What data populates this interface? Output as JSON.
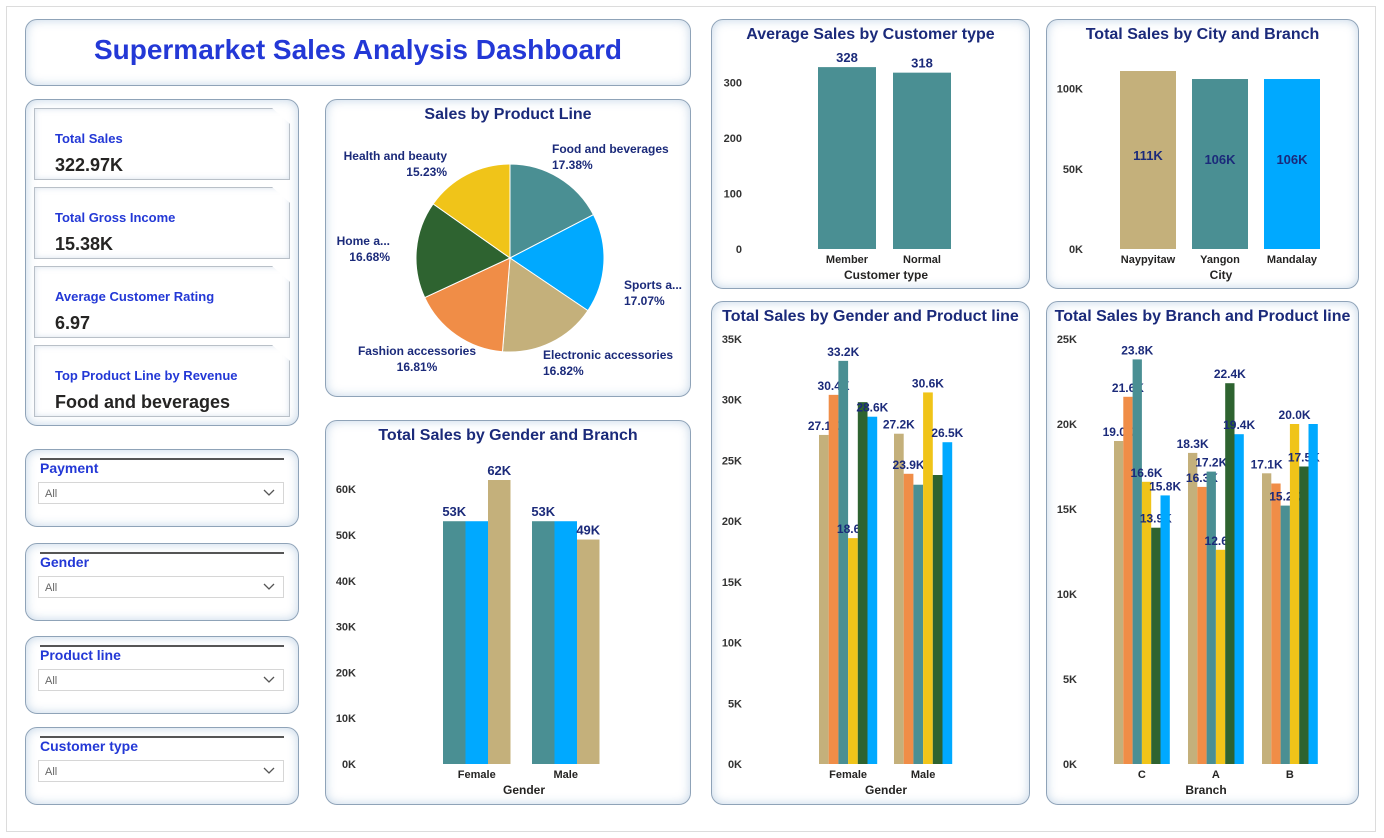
{
  "title": "Supermarket Sales Analysis Dashboard",
  "kpis": [
    {
      "label": "Total Sales",
      "value": "322.97K"
    },
    {
      "label": "Total Gross Income",
      "value": "15.38K"
    },
    {
      "label": "Average Customer Rating",
      "value": "6.97"
    },
    {
      "label": "Top Product Line by Revenue",
      "value": "Food and beverages"
    }
  ],
  "slicers": [
    {
      "title": "Payment",
      "value": "All"
    },
    {
      "title": "Gender",
      "value": "All"
    },
    {
      "title": "Product line",
      "value": "All"
    },
    {
      "title": "Customer type",
      "value": "All"
    }
  ],
  "colors": {
    "title": "#2338d6",
    "chart_title": "#1b2a7a",
    "teal": "#4a8f93",
    "blue": "#00a9ff",
    "tan": "#c4b07b",
    "orange": "#f08d47",
    "yellow": "#f0c419",
    "darkgreen": "#2e6330"
  },
  "chart_data": [
    {
      "id": "pie",
      "type": "pie",
      "title": "Sales by Product Line",
      "slices": [
        {
          "label": "Food and beverages",
          "pct_label": "17.38%",
          "value": 17.38,
          "color": "#4a8f93"
        },
        {
          "label": "Sports a...",
          "pct_label": "17.07%",
          "value": 17.07,
          "color": "#00a9ff"
        },
        {
          "label": "Electronic accessories",
          "pct_label": "16.82%",
          "value": 16.82,
          "color": "#c4b07b"
        },
        {
          "label": "Fashion accessories",
          "pct_label": "16.81%",
          "value": 16.81,
          "color": "#f08d47"
        },
        {
          "label": "Home a...",
          "pct_label": "16.68%",
          "value": 16.68,
          "color": "#2e6330"
        },
        {
          "label": "Health and beauty",
          "pct_label": "15.23%",
          "value": 15.23,
          "color": "#f0c419"
        }
      ]
    },
    {
      "id": "avg_cust",
      "type": "bar",
      "title": "Average Sales by Customer type",
      "xlabel": "Customer type",
      "ylabel": "",
      "categories": [
        "Member",
        "Normal"
      ],
      "ylim": [
        0,
        330
      ],
      "ticks": [
        0,
        100,
        200,
        300
      ],
      "tick_labels": [
        "0",
        "100",
        "200",
        "300"
      ],
      "series": [
        {
          "color": "#4a8f93",
          "values": [
            328,
            318
          ],
          "labels": [
            "328",
            "318"
          ]
        }
      ]
    },
    {
      "id": "city_branch",
      "type": "bar",
      "title": "Total Sales by City and Branch",
      "xlabel": "City",
      "ylabel": "",
      "categories": [
        "Naypyitaw",
        "Yangon",
        "Mandalay"
      ],
      "ylim": [
        0,
        111000
      ],
      "ticks": [
        0,
        50000,
        100000
      ],
      "tick_labels": [
        "0K",
        "50K",
        "100K"
      ],
      "series": [
        {
          "colors": [
            "#c4b07b",
            "#4a8f93",
            "#00a9ff"
          ],
          "values": [
            111000,
            106000,
            106000
          ],
          "labels": [
            "111K",
            "106K",
            "106K"
          ]
        }
      ]
    },
    {
      "id": "gender_branch",
      "type": "bar",
      "title": "Total Sales by Gender and Branch",
      "xlabel": "Gender",
      "ylabel": "",
      "categories": [
        "Female",
        "Male"
      ],
      "ylim": [
        0,
        62000
      ],
      "ticks": [
        0,
        10000,
        20000,
        30000,
        40000,
        50000,
        60000
      ],
      "tick_labels": [
        "0K",
        "10K",
        "20K",
        "30K",
        "40K",
        "50K",
        "60K"
      ],
      "series": [
        {
          "color": "#4a8f93",
          "values": [
            53000,
            53000
          ],
          "labels": [
            "53K",
            "53K"
          ]
        },
        {
          "color": "#00a9ff",
          "values": [
            53000,
            53000
          ],
          "labels": [
            "",
            ""
          ]
        },
        {
          "color": "#c4b07b",
          "values": [
            62000,
            49000
          ],
          "labels": [
            "62K",
            "49K"
          ]
        }
      ]
    },
    {
      "id": "gender_product",
      "type": "bar",
      "title": "Total Sales by Gender and Product line",
      "xlabel": "Gender",
      "ylabel": "",
      "categories": [
        "Female",
        "Male"
      ],
      "ylim": [
        0,
        35000
      ],
      "ticks": [
        0,
        5000,
        10000,
        15000,
        20000,
        25000,
        30000,
        35000
      ],
      "tick_labels": [
        "0K",
        "5K",
        "10K",
        "15K",
        "20K",
        "25K",
        "30K",
        "35K"
      ],
      "series": [
        {
          "color": "#c4b07b",
          "values": [
            27100,
            27200
          ],
          "labels": [
            "27.1K",
            "27.2K"
          ]
        },
        {
          "color": "#f08d47",
          "values": [
            30400,
            23900
          ],
          "labels": [
            "30.4K",
            "23.9K"
          ]
        },
        {
          "color": "#4a8f93",
          "values": [
            33200,
            23000
          ],
          "labels": [
            "33.2K",
            ""
          ]
        },
        {
          "color": "#f0c419",
          "values": [
            18600,
            30600
          ],
          "labels": [
            "18.6K",
            "30.6K"
          ]
        },
        {
          "color": "#2e6330",
          "values": [
            29800,
            23800
          ],
          "labels": [
            "",
            ""
          ]
        },
        {
          "color": "#00a9ff",
          "values": [
            28600,
            26500
          ],
          "labels": [
            "28.6K",
            "26.5K"
          ]
        }
      ]
    },
    {
      "id": "branch_product",
      "type": "bar",
      "title": "Total Sales by Branch and Product line",
      "xlabel": "Branch",
      "ylabel": "",
      "categories": [
        "C",
        "A",
        "B"
      ],
      "ylim": [
        0,
        25000
      ],
      "ticks": [
        0,
        5000,
        10000,
        15000,
        20000,
        25000
      ],
      "tick_labels": [
        "0K",
        "5K",
        "10K",
        "15K",
        "20K",
        "25K"
      ],
      "series": [
        {
          "color": "#c4b07b",
          "values": [
            19000,
            18300,
            17100
          ],
          "labels": [
            "19.0K",
            "18.3K",
            "17.1K"
          ]
        },
        {
          "color": "#f08d47",
          "values": [
            21600,
            16300,
            16500
          ],
          "labels": [
            "21.6K",
            "16.3K",
            ""
          ]
        },
        {
          "color": "#4a8f93",
          "values": [
            23800,
            17200,
            15200
          ],
          "labels": [
            "23.8K",
            "17.2K",
            "15.2K"
          ]
        },
        {
          "color": "#f0c419",
          "values": [
            16600,
            12600,
            20000
          ],
          "labels": [
            "16.6K",
            "12.6K",
            "20.0K"
          ]
        },
        {
          "color": "#2e6330",
          "values": [
            13900,
            22400,
            17500
          ],
          "labels": [
            "13.9K",
            "22.4K",
            "17.5K"
          ]
        },
        {
          "color": "#00a9ff",
          "values": [
            15800,
            19400,
            20000
          ],
          "labels": [
            "15.8K",
            "19.4K",
            ""
          ]
        }
      ]
    }
  ]
}
